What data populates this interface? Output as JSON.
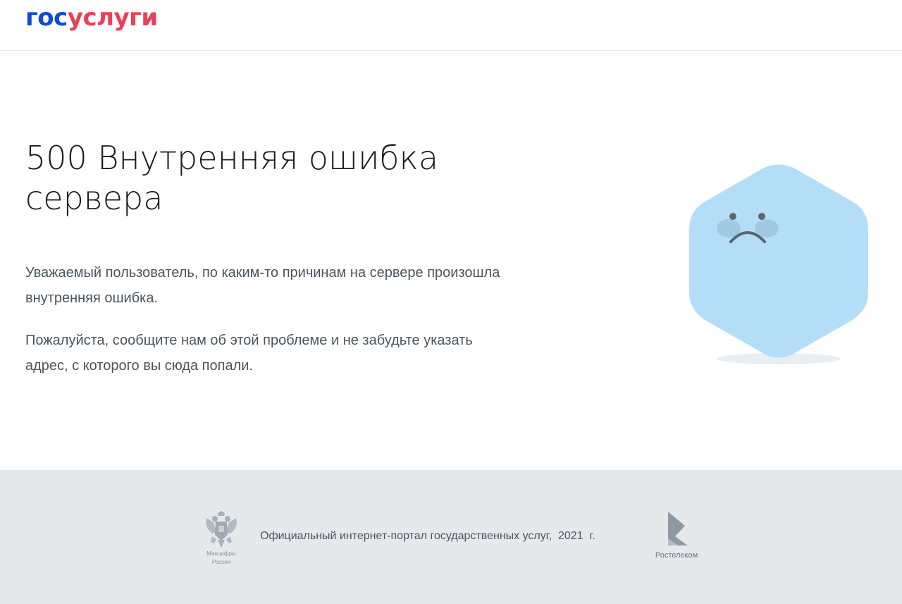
{
  "header": {
    "logo_part1": "гос",
    "logo_part2": "услуги",
    "logo_colors": {
      "part1": "#0d4cd3",
      "part2": "#ee3f58"
    }
  },
  "main": {
    "title": "500 Внутренняя ошибка сервера",
    "paragraph1": "Уважаемый пользователь, по каким-то причинам на сервере произошла внутренняя ошибка.",
    "paragraph2": "Пожалуйста, сообщите нам об этой проблеме и не забудьте указать адрес, с которого вы сюда попали.",
    "illustration_icon": "sad-face-hexagon-icon",
    "illustration_color": "#b4def8"
  },
  "footer": {
    "emblem_icon": "russian-coat-of-arms-icon",
    "emblem_caption_line1": "Минцифры",
    "emblem_caption_line2": "России",
    "text": "Официальный интернет-портал государственных услуг,  2021  г.",
    "partner_icon": "rostelecom-logo-icon",
    "partner_name": "Ростелеком",
    "background": "#e5e9ec"
  }
}
